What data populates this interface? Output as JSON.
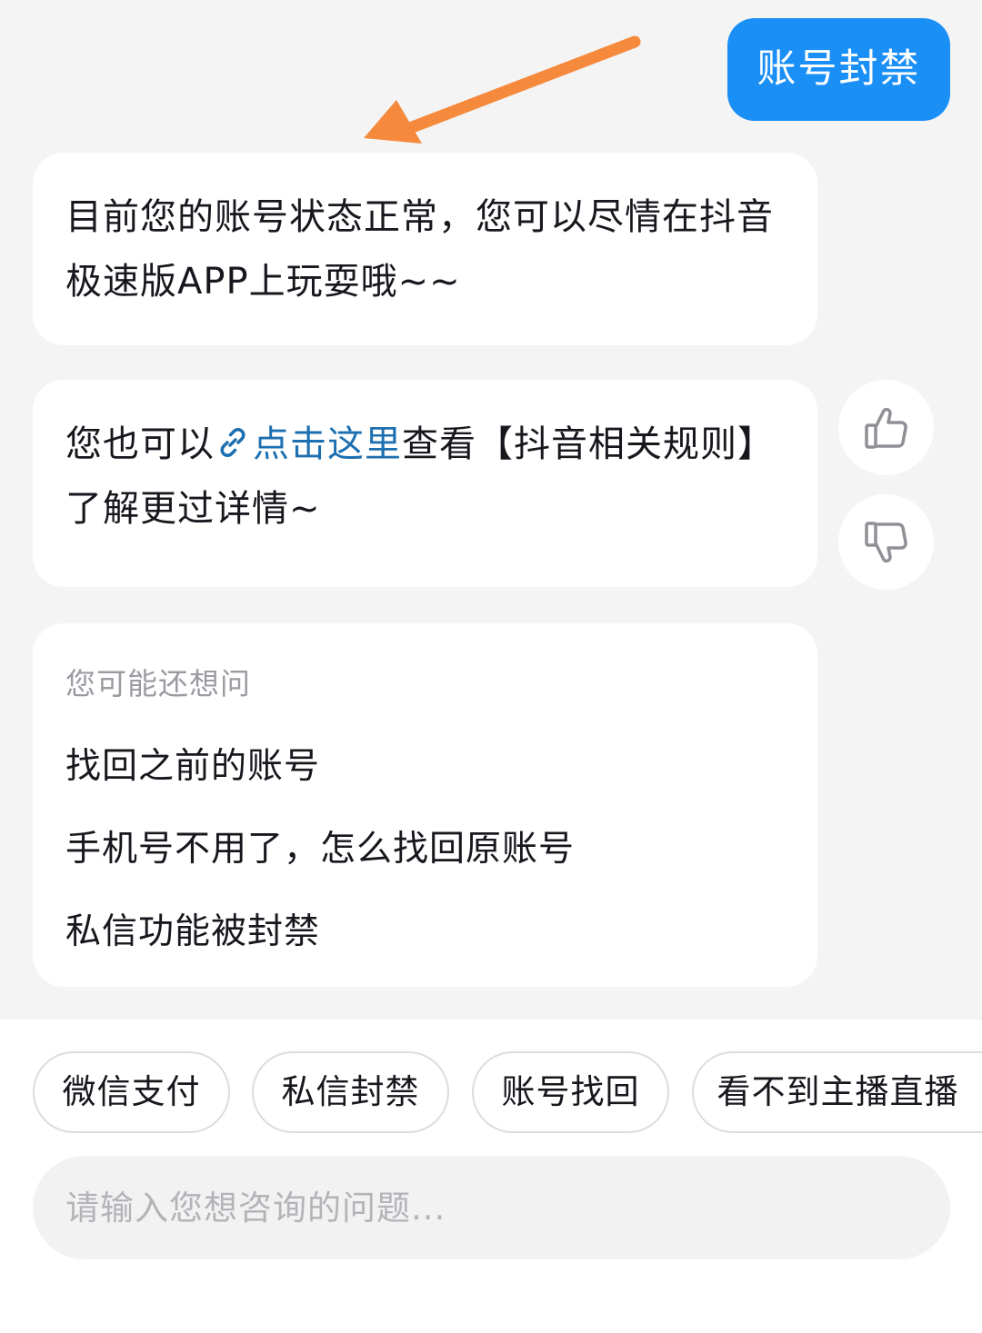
{
  "user_message": {
    "text": "账号封禁"
  },
  "bot_reply_1": {
    "text": "目前您的账号状态正常，您可以尽情在抖音极速版APP上玩耍哦~~"
  },
  "bot_reply_2": {
    "before": "您也可以",
    "link_text": "点击这里",
    "after": "查看【抖音相关规则】了解更过详情~",
    "link_icon": "link-icon"
  },
  "feedback": {
    "like_icon": "thumbs-up-icon",
    "dislike_icon": "thumbs-down-icon"
  },
  "suggestions": {
    "title": "您可能还想问",
    "items": [
      "找回之前的账号",
      "手机号不用了，怎么找回原账号",
      "私信功能被封禁"
    ]
  },
  "quick_chips": [
    "微信支付",
    "私信封禁",
    "账号找回",
    "看不到主播直播"
  ],
  "input": {
    "placeholder": "请输入您想咨询的问题..."
  },
  "colors": {
    "accent": "#1a8ff5",
    "link": "#1c6fb0",
    "annotation_arrow": "#f58a3c",
    "background": "#f4f4f5"
  }
}
